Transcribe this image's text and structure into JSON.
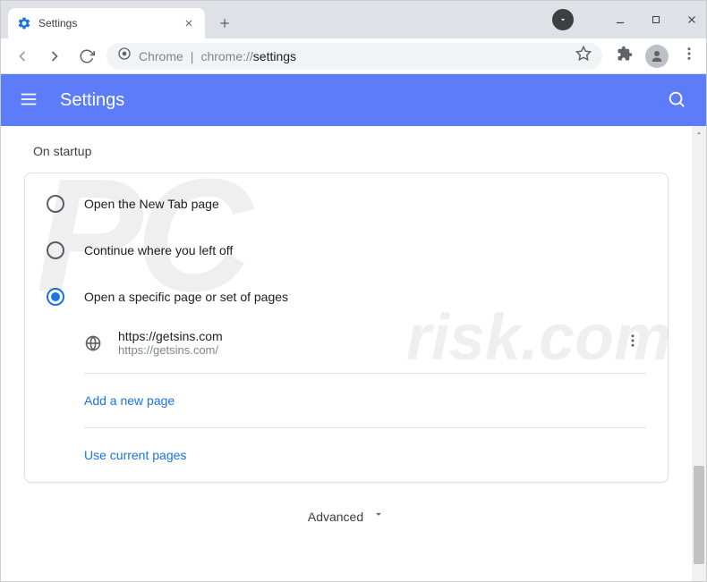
{
  "tab": {
    "title": "Settings"
  },
  "omnibox": {
    "chrome_label": "Chrome",
    "url_prefix": "chrome://",
    "url_path": "settings"
  },
  "header": {
    "title": "Settings"
  },
  "section": {
    "title": "On startup"
  },
  "radios": {
    "new_tab": "Open the New Tab page",
    "continue": "Continue where you left off",
    "specific": "Open a specific page or set of pages"
  },
  "page_entry": {
    "title": "https://getsins.com",
    "url": "https://getsins.com/"
  },
  "links": {
    "add_page": "Add a new page",
    "use_current": "Use current pages"
  },
  "advanced": {
    "label": "Advanced"
  },
  "watermark": {
    "main": "PC",
    "sub": "risk.com"
  }
}
